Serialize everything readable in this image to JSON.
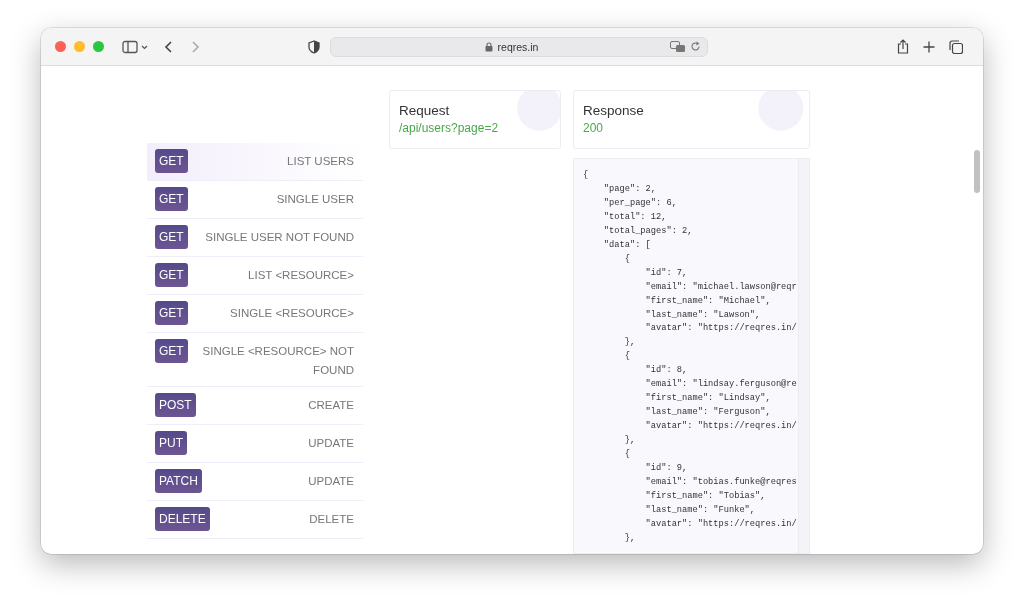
{
  "browser": {
    "url": "reqres.in"
  },
  "endpoints": [
    {
      "method": "GET",
      "label": "LIST USERS",
      "selected": true
    },
    {
      "method": "GET",
      "label": "SINGLE USER",
      "selected": false
    },
    {
      "method": "GET",
      "label": "SINGLE USER NOT FOUND",
      "selected": false
    },
    {
      "method": "GET",
      "label": "LIST <RESOURCE>",
      "selected": false
    },
    {
      "method": "GET",
      "label": "SINGLE <RESOURCE>",
      "selected": false
    },
    {
      "method": "GET",
      "label": "SINGLE <RESOURCE> NOT FOUND",
      "selected": false
    },
    {
      "method": "POST",
      "label": "CREATE",
      "selected": false
    },
    {
      "method": "PUT",
      "label": "UPDATE",
      "selected": false
    },
    {
      "method": "PATCH",
      "label": "UPDATE",
      "selected": false
    },
    {
      "method": "DELETE",
      "label": "DELETE",
      "selected": false
    }
  ],
  "request": {
    "title": "Request",
    "path": "/api/users?page=2"
  },
  "response": {
    "title": "Response",
    "status": "200"
  },
  "response_body": [
    "{",
    "    \"page\": 2,",
    "    \"per_page\": 6,",
    "    \"total\": 12,",
    "    \"total_pages\": 2,",
    "    \"data\": [",
    "        {",
    "            \"id\": 7,",
    "            \"email\": \"michael.lawson@reqr",
    "            \"first_name\": \"Michael\",",
    "            \"last_name\": \"Lawson\",",
    "            \"avatar\": \"https://reqres.in/",
    "        },",
    "        {",
    "            \"id\": 8,",
    "            \"email\": \"lindsay.ferguson@re",
    "            \"first_name\": \"Lindsay\",",
    "            \"last_name\": \"Ferguson\",",
    "            \"avatar\": \"https://reqres.in/",
    "        },",
    "        {",
    "            \"id\": 9,",
    "            \"email\": \"tobias.funke@reqres",
    "            \"first_name\": \"Tobias\",",
    "            \"last_name\": \"Funke\",",
    "            \"avatar\": \"https://reqres.in/",
    "        },"
  ]
}
